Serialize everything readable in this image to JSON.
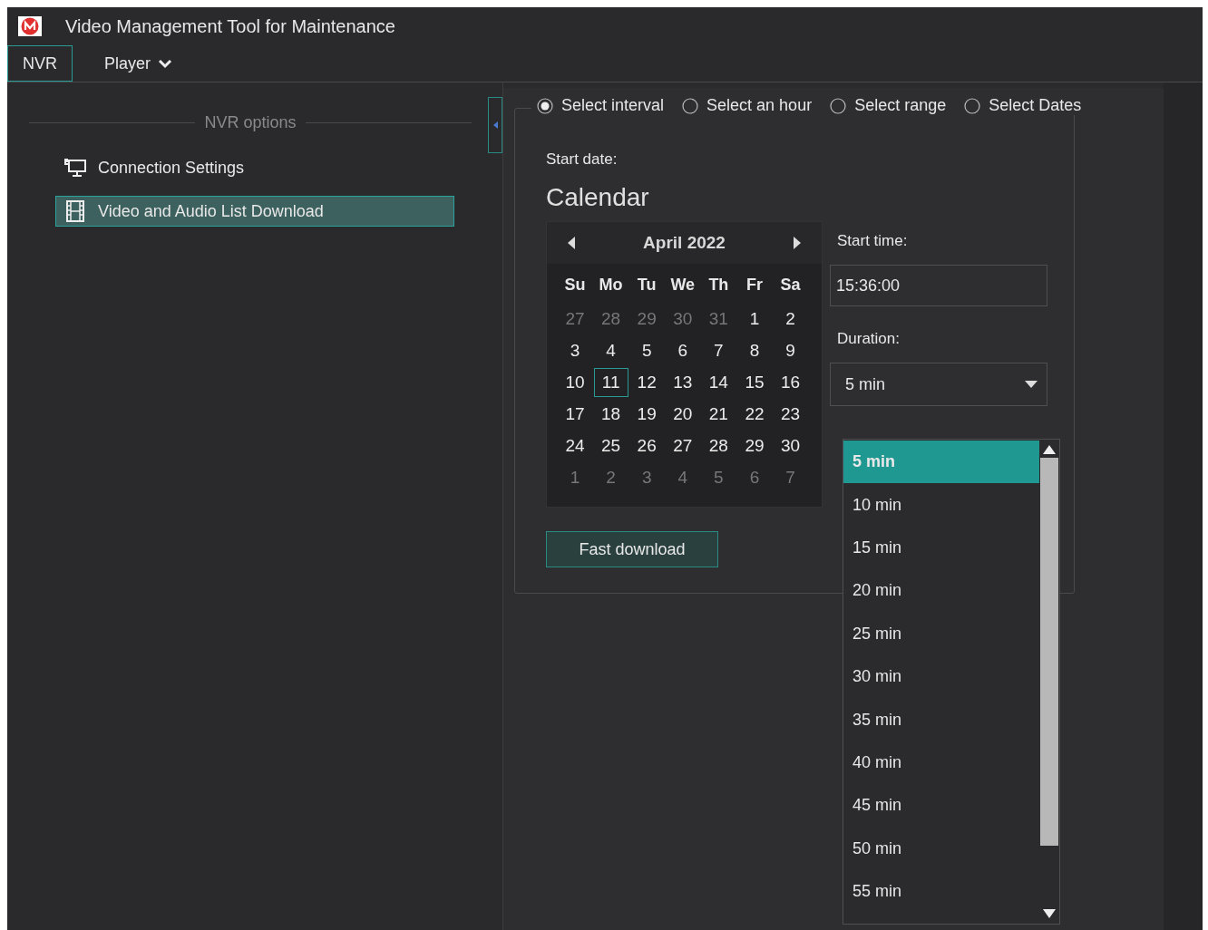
{
  "window": {
    "title": "Video Management Tool for Maintenance"
  },
  "menu": [
    {
      "label": "NVR",
      "selected": true,
      "has_dropdown": false
    },
    {
      "label": "Player",
      "selected": false,
      "has_dropdown": true
    }
  ],
  "sidebar": {
    "heading": "NVR options",
    "items": [
      {
        "label": "Connection Settings",
        "selected": false
      },
      {
        "label": "Video and Audio List Download",
        "selected": true
      }
    ]
  },
  "modes": [
    {
      "label": "Select interval",
      "selected": true
    },
    {
      "label": "Select an hour",
      "selected": false
    },
    {
      "label": "Select range",
      "selected": false
    },
    {
      "label": "Select Dates",
      "selected": false
    }
  ],
  "start_date_label": "Start date:",
  "calendar": {
    "title": "Calendar",
    "month": "April 2022",
    "weekdays": [
      "Su",
      "Mo",
      "Tu",
      "We",
      "Th",
      "Fr",
      "Sa"
    ],
    "days": [
      {
        "label": "27",
        "muted": true,
        "selected": false
      },
      {
        "label": "28",
        "muted": true,
        "selected": false
      },
      {
        "label": "29",
        "muted": true,
        "selected": false
      },
      {
        "label": "30",
        "muted": true,
        "selected": false
      },
      {
        "label": "31",
        "muted": true,
        "selected": false
      },
      {
        "label": "1",
        "muted": false,
        "selected": false
      },
      {
        "label": "2",
        "muted": false,
        "selected": false
      },
      {
        "label": "3",
        "muted": false,
        "selected": false
      },
      {
        "label": "4",
        "muted": false,
        "selected": false
      },
      {
        "label": "5",
        "muted": false,
        "selected": false
      },
      {
        "label": "6",
        "muted": false,
        "selected": false
      },
      {
        "label": "7",
        "muted": false,
        "selected": false
      },
      {
        "label": "8",
        "muted": false,
        "selected": false
      },
      {
        "label": "9",
        "muted": false,
        "selected": false
      },
      {
        "label": "10",
        "muted": false,
        "selected": false
      },
      {
        "label": "11",
        "muted": false,
        "selected": true
      },
      {
        "label": "12",
        "muted": false,
        "selected": false
      },
      {
        "label": "13",
        "muted": false,
        "selected": false
      },
      {
        "label": "14",
        "muted": false,
        "selected": false
      },
      {
        "label": "15",
        "muted": false,
        "selected": false
      },
      {
        "label": "16",
        "muted": false,
        "selected": false
      },
      {
        "label": "17",
        "muted": false,
        "selected": false
      },
      {
        "label": "18",
        "muted": false,
        "selected": false
      },
      {
        "label": "19",
        "muted": false,
        "selected": false
      },
      {
        "label": "20",
        "muted": false,
        "selected": false
      },
      {
        "label": "21",
        "muted": false,
        "selected": false
      },
      {
        "label": "22",
        "muted": false,
        "selected": false
      },
      {
        "label": "23",
        "muted": false,
        "selected": false
      },
      {
        "label": "24",
        "muted": false,
        "selected": false
      },
      {
        "label": "25",
        "muted": false,
        "selected": false
      },
      {
        "label": "26",
        "muted": false,
        "selected": false
      },
      {
        "label": "27",
        "muted": false,
        "selected": false
      },
      {
        "label": "28",
        "muted": false,
        "selected": false
      },
      {
        "label": "29",
        "muted": false,
        "selected": false
      },
      {
        "label": "30",
        "muted": false,
        "selected": false
      },
      {
        "label": "1",
        "muted": true,
        "selected": false
      },
      {
        "label": "2",
        "muted": true,
        "selected": false
      },
      {
        "label": "3",
        "muted": true,
        "selected": false
      },
      {
        "label": "4",
        "muted": true,
        "selected": false
      },
      {
        "label": "5",
        "muted": true,
        "selected": false
      },
      {
        "label": "6",
        "muted": true,
        "selected": false
      },
      {
        "label": "7",
        "muted": true,
        "selected": false
      }
    ]
  },
  "start_time": {
    "label": "Start time:",
    "value": "15:36:00"
  },
  "duration": {
    "label": "Duration:",
    "value": "5 min",
    "options": [
      {
        "label": "5 min",
        "selected": true
      },
      {
        "label": "10 min",
        "selected": false
      },
      {
        "label": "15 min",
        "selected": false
      },
      {
        "label": "20 min",
        "selected": false
      },
      {
        "label": "25 min",
        "selected": false
      },
      {
        "label": "30 min",
        "selected": false
      },
      {
        "label": "35 min",
        "selected": false
      },
      {
        "label": "40 min",
        "selected": false
      },
      {
        "label": "45 min",
        "selected": false
      },
      {
        "label": "50 min",
        "selected": false
      },
      {
        "label": "55 min",
        "selected": false
      }
    ]
  },
  "fast_download": "Fast download"
}
